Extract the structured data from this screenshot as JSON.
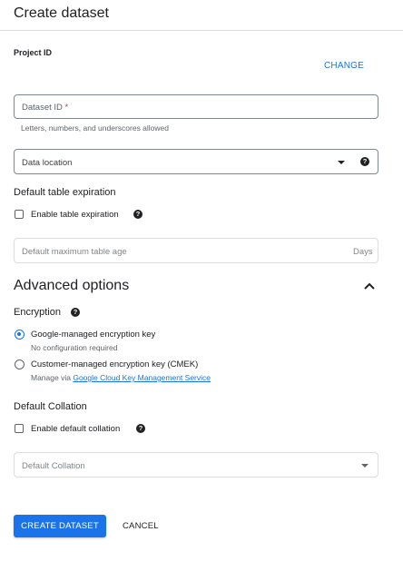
{
  "header": {
    "title": "Create dataset"
  },
  "project": {
    "label": "Project ID",
    "change_label": "CHANGE"
  },
  "dataset_id": {
    "placeholder": "Dataset ID",
    "required_mark": "*",
    "hint": "Letters, numbers, and underscores allowed"
  },
  "data_location": {
    "placeholder": "Data location"
  },
  "table_expiration": {
    "heading": "Default table expiration",
    "checkbox_label": "Enable table expiration",
    "age_placeholder": "Default maximum table age",
    "age_unit": "Days"
  },
  "advanced": {
    "heading": "Advanced options"
  },
  "encryption": {
    "heading": "Encryption",
    "option_google": "Google-managed encryption key",
    "option_google_hint": "No configuration required",
    "option_cmek": "Customer-managed encryption key (CMEK)",
    "option_cmek_hint_prefix": "Manage via",
    "option_cmek_link": "Google Cloud Key Management Service"
  },
  "collation": {
    "heading": "Default Collation",
    "checkbox_label": "Enable default collation",
    "select_placeholder": "Default Collation"
  },
  "actions": {
    "create_label": "CREATE DATASET",
    "cancel_label": "CANCEL"
  },
  "colors": {
    "accent": "#1a73e8",
    "required": "#d93025"
  },
  "icons": {
    "help": "help-icon",
    "dropdown": "caret-down-icon",
    "collapse": "chevron-up-icon"
  }
}
